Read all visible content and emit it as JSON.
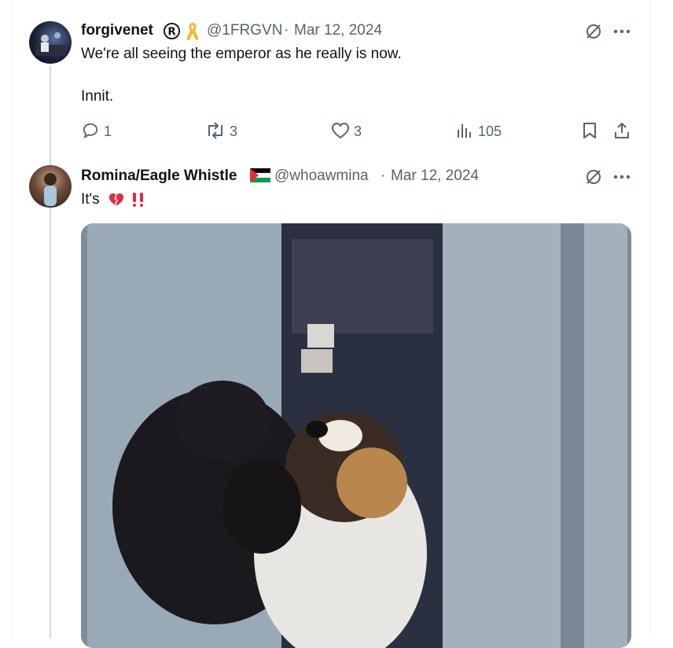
{
  "tweet1": {
    "display_name": "forgivenet",
    "badge": "registered-mark-icon",
    "handle": "@1FRGVN",
    "separator": "·",
    "date": "Mar 12, 2024",
    "lines": [
      "We're all seeing the emperor as he really is now.",
      "Innit."
    ],
    "actions": {
      "reply_count": "1",
      "retweet_count": "3",
      "like_count": "3",
      "views_count": "105"
    }
  },
  "tweet2": {
    "display_name": "Romina/Eagle Whistle",
    "handle": "@whoawmina",
    "separator": "·",
    "date": "Mar 12, 2024",
    "text_prefix": "It's",
    "media_alt": "GIF of a dog hugging a person"
  },
  "colors": {
    "text": "#0f1419",
    "secondary": "#536471",
    "thread": "#cfd9de",
    "accent_red": "#e0245e"
  }
}
